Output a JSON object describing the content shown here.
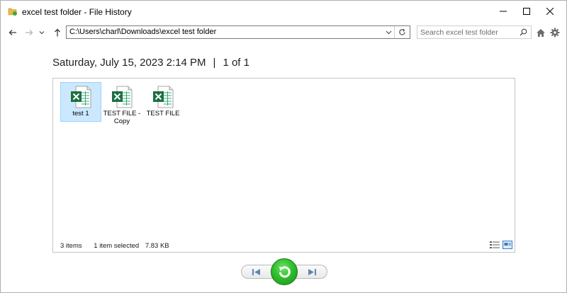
{
  "window": {
    "title": "excel test folder - File History"
  },
  "nav": {
    "address": "C:\\Users\\charl\\Downloads\\excel test folder",
    "search_placeholder": "Search excel test folder"
  },
  "heading": {
    "date": "Saturday, July 15, 2023 2:14 PM",
    "separator": "|",
    "position": "1 of 1"
  },
  "files": [
    {
      "line1": "test 1",
      "line2": "",
      "selected": true
    },
    {
      "line1": "TEST FILE -",
      "line2": "Copy",
      "selected": false
    },
    {
      "line1": "TEST FILE",
      "line2": "",
      "selected": false
    }
  ],
  "status": {
    "item_count": "3 items",
    "selection": "1 item selected",
    "size": "7.83 KB"
  },
  "colors": {
    "excel_green": "#1d6f42",
    "selection_bg": "#cce8ff",
    "restore_green": "#2fbf2b"
  },
  "icons": {
    "title": "file-history-folder-icon",
    "file": "excel-file-icon",
    "restore": "restore-arrow-icon"
  }
}
